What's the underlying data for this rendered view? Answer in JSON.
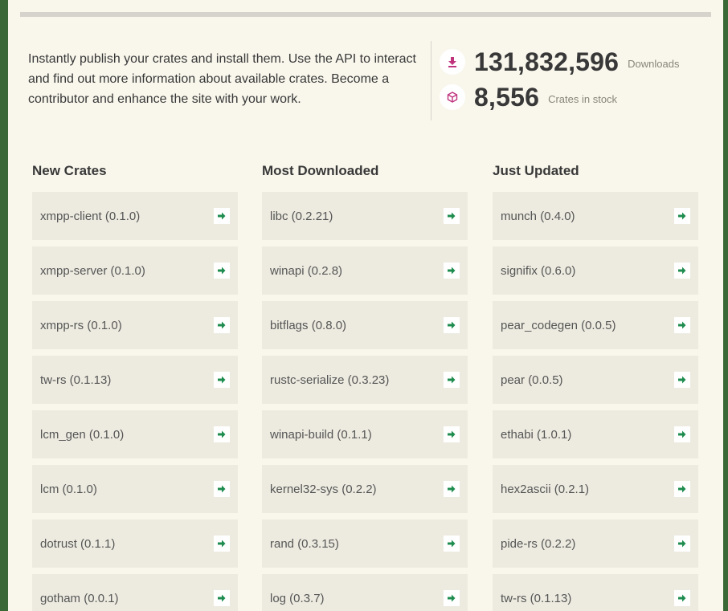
{
  "intro": {
    "text": "Instantly publish your crates and install them. Use the API to interact and find out more information about available crates. Become a contributor and enhance the site with your work."
  },
  "stats": {
    "downloads": {
      "value": "131,832,596",
      "label": "Downloads",
      "icon": "download-icon"
    },
    "stock": {
      "value": "8,556",
      "label": "Crates in stock",
      "icon": "box-icon"
    }
  },
  "colors": {
    "accent_pink": "#c0347e",
    "accent_green": "#1e8c4e",
    "background": "#f9f7ec",
    "row_bg": "#edebe0",
    "frame_green": "#3b6837"
  },
  "columns": [
    {
      "title": "New Crates",
      "items": [
        {
          "label": "xmpp-client (0.1.0)"
        },
        {
          "label": "xmpp-server (0.1.0)"
        },
        {
          "label": "xmpp-rs (0.1.0)"
        },
        {
          "label": "tw-rs (0.1.13)"
        },
        {
          "label": "lcm_gen (0.1.0)"
        },
        {
          "label": "lcm (0.1.0)"
        },
        {
          "label": "dotrust (0.1.1)"
        },
        {
          "label": "gotham (0.0.1)"
        }
      ]
    },
    {
      "title": "Most Downloaded",
      "items": [
        {
          "label": "libc (0.2.21)"
        },
        {
          "label": "winapi (0.2.8)"
        },
        {
          "label": "bitflags (0.8.0)"
        },
        {
          "label": "rustc-serialize (0.3.23)"
        },
        {
          "label": "winapi-build (0.1.1)"
        },
        {
          "label": "kernel32-sys (0.2.2)"
        },
        {
          "label": "rand (0.3.15)"
        },
        {
          "label": "log (0.3.7)"
        }
      ]
    },
    {
      "title": "Just Updated",
      "items": [
        {
          "label": "munch (0.4.0)"
        },
        {
          "label": "signifix (0.6.0)"
        },
        {
          "label": "pear_codegen (0.0.5)"
        },
        {
          "label": "pear (0.0.5)"
        },
        {
          "label": "ethabi (1.0.1)"
        },
        {
          "label": "hex2ascii (0.2.1)"
        },
        {
          "label": "pide-rs (0.2.2)"
        },
        {
          "label": "tw-rs (0.1.13)"
        }
      ]
    }
  ]
}
